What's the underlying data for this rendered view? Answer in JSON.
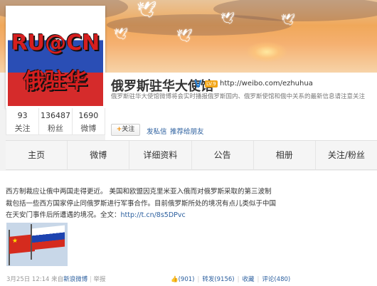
{
  "profile": {
    "avatar_text_line1": "RU@CN",
    "avatar_text_line2": "俄驻华",
    "name": "俄罗斯驻华大使馆",
    "verified_icon": "V",
    "vip_badge": "LV.9",
    "url": "http://weibo.com/ezhuhua",
    "description": "俄罗斯驻华大使馆微博将会实时播报俄罗斯国内、俄罗斯使馆和俄中关系的最新信息请注意关注",
    "follow_button": "关注",
    "follow_plus": "+",
    "message_link": "发私信",
    "recommend_link": "推荐给朋友"
  },
  "stats": [
    {
      "value": "93",
      "label": "关注"
    },
    {
      "value": "136487",
      "label": "粉丝"
    },
    {
      "value": "1690",
      "label": "微博"
    }
  ],
  "tabs": [
    "主页",
    "微博",
    "详细资料",
    "公告",
    "相册",
    "关注/粉丝"
  ],
  "post": {
    "text_line1": "西方制裁应让俄中两国走得更近。 美国和欧盟因克里米亚入俄而对俄罗斯采取的第三波制",
    "text_line2": "裁包括一些西方国家停止同俄罗斯进行军事合作。目前俄罗斯所处的境况有点儿类似于中国",
    "text_line3_prefix": "在天安门事件后所遭遇的境况。全文：",
    "text_link": "http://t.cn/8s5DPvc",
    "date": "3月25日 12:14",
    "source_prefix": "来自",
    "source": "新浪微博",
    "report": "举报",
    "likes": "(901)",
    "repost": "转发(9156)",
    "favorite": "收藏",
    "comment": "评论(480)"
  }
}
